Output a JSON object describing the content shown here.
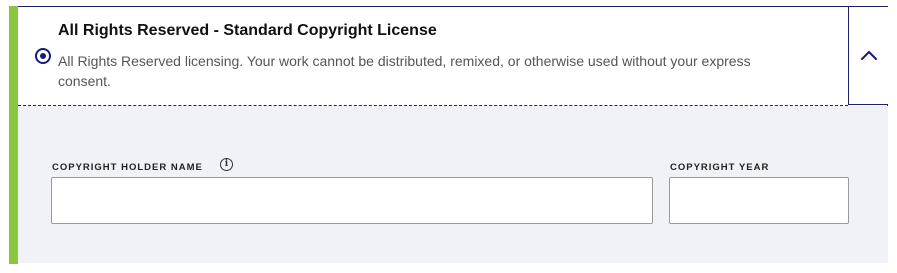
{
  "license_option": {
    "title": "All Rights Reserved - Standard Copyright License",
    "description": "All Rights Reserved licensing. Your work cannot be distributed, remixed, or otherwise used without your express consent.",
    "selected": true,
    "expanded": true,
    "toggle_icon": "chevron-up-icon"
  },
  "form": {
    "holder_label": "COPYRIGHT HOLDER NAME",
    "holder_info_glyph": "i",
    "holder_value": "",
    "holder_placeholder": "",
    "year_label": "COPYRIGHT YEAR",
    "year_value": "",
    "year_placeholder": ""
  },
  "colors": {
    "accent": "#8cc63f",
    "border": "#1f1f6b",
    "radio": "#1a1a7a",
    "panel_background": "#f1f2f8"
  }
}
